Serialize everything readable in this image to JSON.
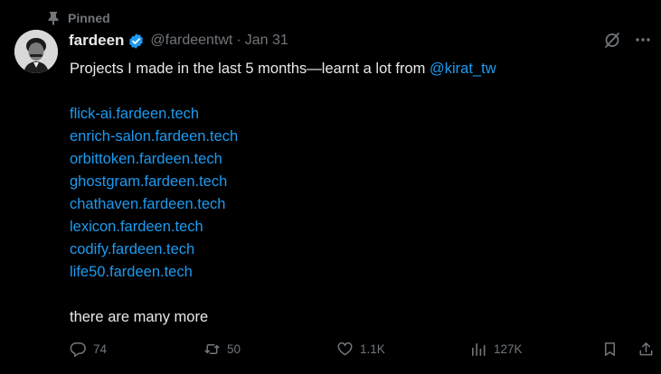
{
  "pinned": {
    "label": "Pinned"
  },
  "author": {
    "display_name": "fardeen",
    "handle": "@fardeentwt",
    "separator": "·",
    "date": "Jan 31"
  },
  "tweet": {
    "text_prefix": "Projects I made in the last 5 months—learnt a lot from ",
    "mention": "@kirat_tw",
    "links": [
      "flick-ai.fardeen.tech",
      "enrich-salon.fardeen.tech",
      "orbittoken.fardeen.tech",
      "ghostgram.fardeen.tech",
      "chathaven.fardeen.tech",
      "lexicon.fardeen.tech",
      "codify.fardeen.tech",
      "life50.fardeen.tech"
    ],
    "closing": "there are many more"
  },
  "actions": {
    "replies": "74",
    "reposts": "50",
    "likes": "1.1K",
    "views": "127K"
  },
  "icons": {
    "pin": "pin-icon",
    "verified": "verified-badge-icon",
    "grok": "grok-icon",
    "more": "more-icon",
    "reply": "reply-icon",
    "repost": "repost-icon",
    "like": "heart-icon",
    "views": "views-icon",
    "bookmark": "bookmark-icon",
    "share": "share-icon"
  },
  "colors": {
    "background": "#000000",
    "text": "#e7e9ea",
    "secondary": "#71767b",
    "accent": "#1d9bf0"
  }
}
